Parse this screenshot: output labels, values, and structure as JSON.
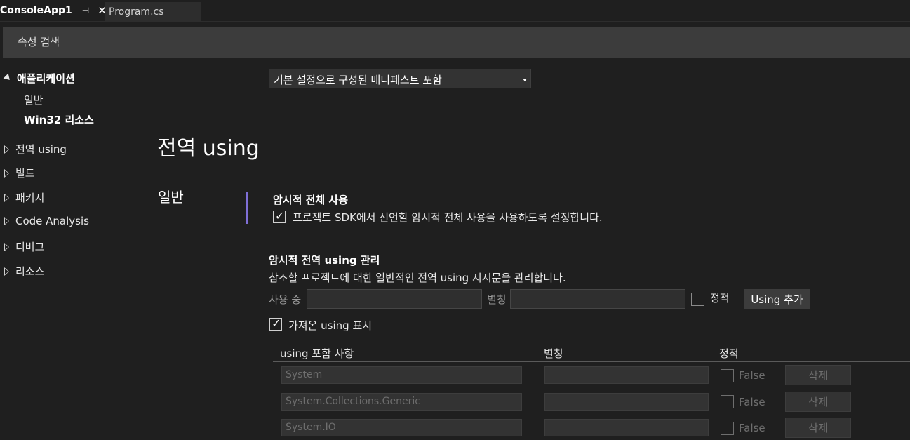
{
  "tabs": {
    "active": {
      "label": "ConsoleApp1",
      "pin_icon": "pin-icon",
      "close_icon": "close-icon"
    },
    "inactive": {
      "label": "Program.cs"
    }
  },
  "search": {
    "placeholder": "속성 검색"
  },
  "sidebar": {
    "application": {
      "label": "애플리케이션",
      "children": [
        "일반",
        "Win32 리소스"
      ]
    },
    "items": [
      "전역 using",
      "빌드",
      "패키지",
      "Code Analysis",
      "디버그",
      "리소스"
    ]
  },
  "manifest_dropdown": {
    "selected": "기본 설정으로 구성된 매니페스트 포함"
  },
  "section": {
    "title": "전역 using",
    "group": "일반",
    "implicit_usings": {
      "title": "암시적 전체 사용",
      "checkbox_label": "프로젝트 SDK에서 선언할 암시적 전체 사용을 사용하도록 설정합니다.",
      "checked": true
    },
    "manage": {
      "title": "암시적 전역 using 관리",
      "description": "참조할 프로젝트에 대한 일반적인 전역 using 지시문을 관리합니다.",
      "using_label": "사용 중",
      "alias_label": "별칭",
      "static_label": "정적",
      "add_button": "Using 추가",
      "show_imported_label": "가져온 using 표시",
      "show_imported_checked": true
    },
    "table": {
      "headers": [
        "using 포함 사항",
        "별칭",
        "정적"
      ],
      "rows": [
        {
          "using": "System",
          "alias": "",
          "static": "False",
          "delete": "삭제"
        },
        {
          "using": "System.Collections.Generic",
          "alias": "",
          "static": "False",
          "delete": "삭제"
        },
        {
          "using": "System.IO",
          "alias": "",
          "static": "False",
          "delete": "삭제"
        }
      ]
    }
  },
  "colors": {
    "accent": "#7f6fd6",
    "background": "#1f1f1f",
    "panel": "#3c3c3c"
  }
}
